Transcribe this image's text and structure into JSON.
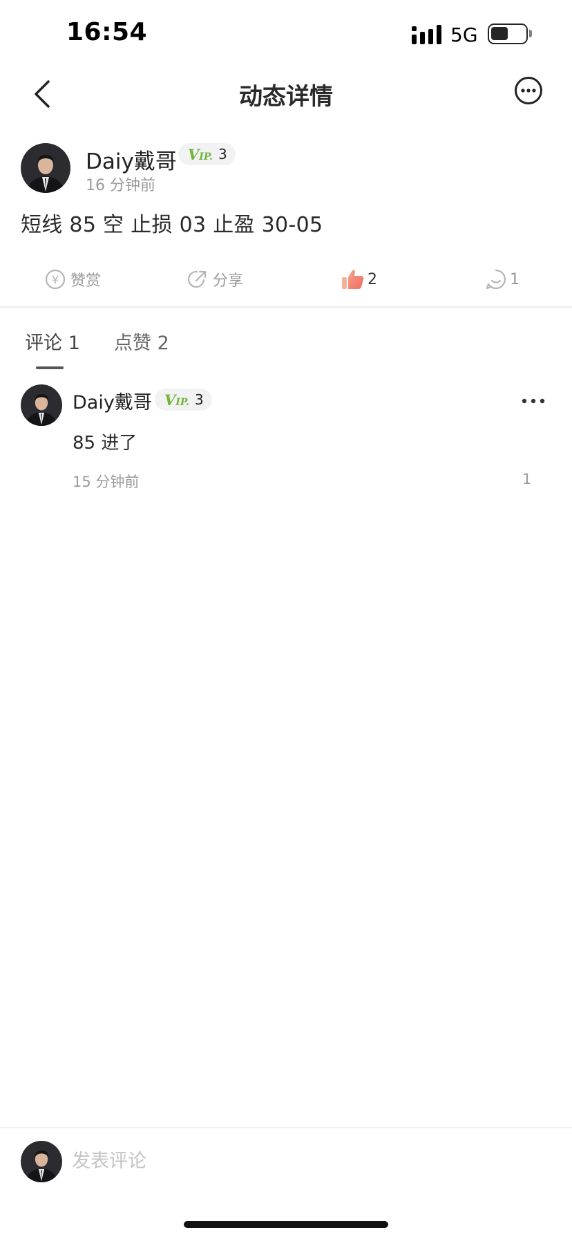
{
  "status_bar": {
    "time": "16:54",
    "network": "5G",
    "battery_level": 0.5
  },
  "nav": {
    "title": "动态详情",
    "back_icon": "chevron-left-icon",
    "more_icon": "more-circle-icon"
  },
  "post": {
    "author": "Daiy戴哥",
    "vip": {
      "mark": "V",
      "mark_small": "IP.",
      "level": "3",
      "color": "#6fb53a"
    },
    "time": "16 分钟前",
    "content": "短线 85 空 止损 03 止盈 30-05"
  },
  "actions": {
    "reward_label": "赞赏",
    "share_label": "分享",
    "like_count": "2",
    "comment_count": "1",
    "like_color": "#f08070"
  },
  "tabs": [
    {
      "label": "评论 1",
      "active": true
    },
    {
      "label": "点赞 2",
      "active": false
    }
  ],
  "comments": [
    {
      "author": "Daiy戴哥",
      "vip_mark": "V",
      "vip_mark_small": "IP.",
      "vip_level": "3",
      "text": "85 进了",
      "time": "15 分钟前",
      "likes": "1"
    }
  ],
  "comment_box": {
    "placeholder": "发表评论"
  }
}
